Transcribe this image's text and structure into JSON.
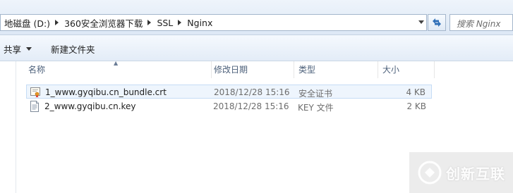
{
  "address_bar": {
    "breadcrumbs": [
      "地磁盘 (D:)",
      "360安全浏览器下载",
      "SSL",
      "Nginx"
    ]
  },
  "search": {
    "placeholder": "搜索 Nginx"
  },
  "toolbar": {
    "share_label": "共享",
    "new_folder_label": "新建文件夹"
  },
  "columns": {
    "name": "名称",
    "date_modified": "修改日期",
    "type": "类型",
    "size": "大小"
  },
  "files": [
    {
      "name": "1_www.gyqibu.cn_bundle.crt",
      "date": "2018/12/28 15:16",
      "type": "安全证书",
      "size": "4 KB",
      "icon": "certificate-icon",
      "selected": true
    },
    {
      "name": "2_www.gyqibu.cn.key",
      "date": "2018/12/28 15:16",
      "type": "KEY 文件",
      "size": "2 KB",
      "icon": "text-file-icon",
      "selected": false
    }
  ],
  "watermark": {
    "text": "创新互联"
  },
  "colors": {
    "selection_bg": "#eef5fd",
    "selection_border": "#c5dcf5",
    "header_text": "#4c607a"
  }
}
